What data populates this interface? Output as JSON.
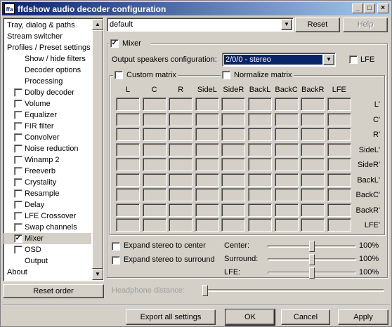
{
  "window": {
    "title": "ffdshow audio decoder configuration",
    "icon_text": "ffa"
  },
  "tree": {
    "items": [
      {
        "label": "Tray, dialog & paths",
        "checkbox": false,
        "indent": 0,
        "selected": false
      },
      {
        "label": "Stream switcher",
        "checkbox": false,
        "indent": 0,
        "selected": false
      },
      {
        "label": "Profiles / Preset settings",
        "checkbox": false,
        "indent": 0,
        "selected": false
      },
      {
        "label": "Show / hide filters",
        "checkbox": false,
        "indent": 2,
        "selected": false
      },
      {
        "label": "Decoder options",
        "checkbox": false,
        "indent": 2,
        "selected": false
      },
      {
        "label": "Processing",
        "checkbox": false,
        "indent": 2,
        "selected": false
      },
      {
        "label": "Dolby decoder",
        "checkbox": true,
        "checked": false,
        "indent": 1,
        "selected": false
      },
      {
        "label": "Volume",
        "checkbox": true,
        "checked": false,
        "indent": 1,
        "selected": false
      },
      {
        "label": "Equalizer",
        "checkbox": true,
        "checked": false,
        "indent": 1,
        "selected": false
      },
      {
        "label": "FIR filter",
        "checkbox": true,
        "checked": false,
        "indent": 1,
        "selected": false
      },
      {
        "label": "Convolver",
        "checkbox": true,
        "checked": false,
        "indent": 1,
        "selected": false
      },
      {
        "label": "Noise reduction",
        "checkbox": true,
        "checked": false,
        "indent": 1,
        "selected": false
      },
      {
        "label": "Winamp 2",
        "checkbox": true,
        "checked": false,
        "indent": 1,
        "selected": false
      },
      {
        "label": "Freeverb",
        "checkbox": true,
        "checked": false,
        "indent": 1,
        "selected": false
      },
      {
        "label": "Crystality",
        "checkbox": true,
        "checked": false,
        "indent": 1,
        "selected": false
      },
      {
        "label": "Resample",
        "checkbox": true,
        "checked": false,
        "indent": 1,
        "selected": false
      },
      {
        "label": "Delay",
        "checkbox": true,
        "checked": false,
        "indent": 1,
        "selected": false
      },
      {
        "label": "LFE Crossover",
        "checkbox": true,
        "checked": false,
        "indent": 1,
        "selected": false
      },
      {
        "label": "Swap channels",
        "checkbox": true,
        "checked": false,
        "indent": 1,
        "selected": false
      },
      {
        "label": "Mixer",
        "checkbox": true,
        "checked": true,
        "indent": 1,
        "selected": true
      },
      {
        "label": "OSD",
        "checkbox": true,
        "checked": false,
        "indent": 1,
        "selected": false
      },
      {
        "label": "Output",
        "checkbox": false,
        "indent": 2,
        "selected": false
      },
      {
        "label": "About",
        "checkbox": false,
        "indent": 0,
        "selected": false
      }
    ]
  },
  "reset_order_label": "Reset order",
  "preset": {
    "value": "default",
    "reset_label": "Reset",
    "help_label": "Help"
  },
  "mixer": {
    "enable_label": "Mixer",
    "enabled": true,
    "output_config_label": "Output speakers configuration:",
    "output_config_value": "2/0/0 - stereo",
    "lfe_label": "LFE",
    "custom_matrix_label": "Custom matrix",
    "normalize_matrix_label": "Normalize matrix",
    "columns": [
      "L",
      "C",
      "R",
      "SideL",
      "SideR",
      "BackL",
      "BackC",
      "BackR",
      "LFE"
    ],
    "rows": [
      "L'",
      "C'",
      "R'",
      "SideL'",
      "SideR'",
      "BackL'",
      "BackC'",
      "BackR'",
      "LFE'"
    ],
    "expand_center_label": "Expand stereo to center",
    "expand_surround_label": "Expand stereo to surround",
    "sliders": [
      {
        "label": "Center:",
        "value": "100%",
        "level": 0.5
      },
      {
        "label": "Surround:",
        "value": "100%",
        "level": 0.5
      },
      {
        "label": "LFE:",
        "value": "100%",
        "level": 0.5
      }
    ],
    "headphone_label": "Headphone distance:"
  },
  "footer": {
    "export_label": "Export all settings",
    "ok_label": "OK",
    "cancel_label": "Cancel",
    "apply_label": "Apply"
  }
}
